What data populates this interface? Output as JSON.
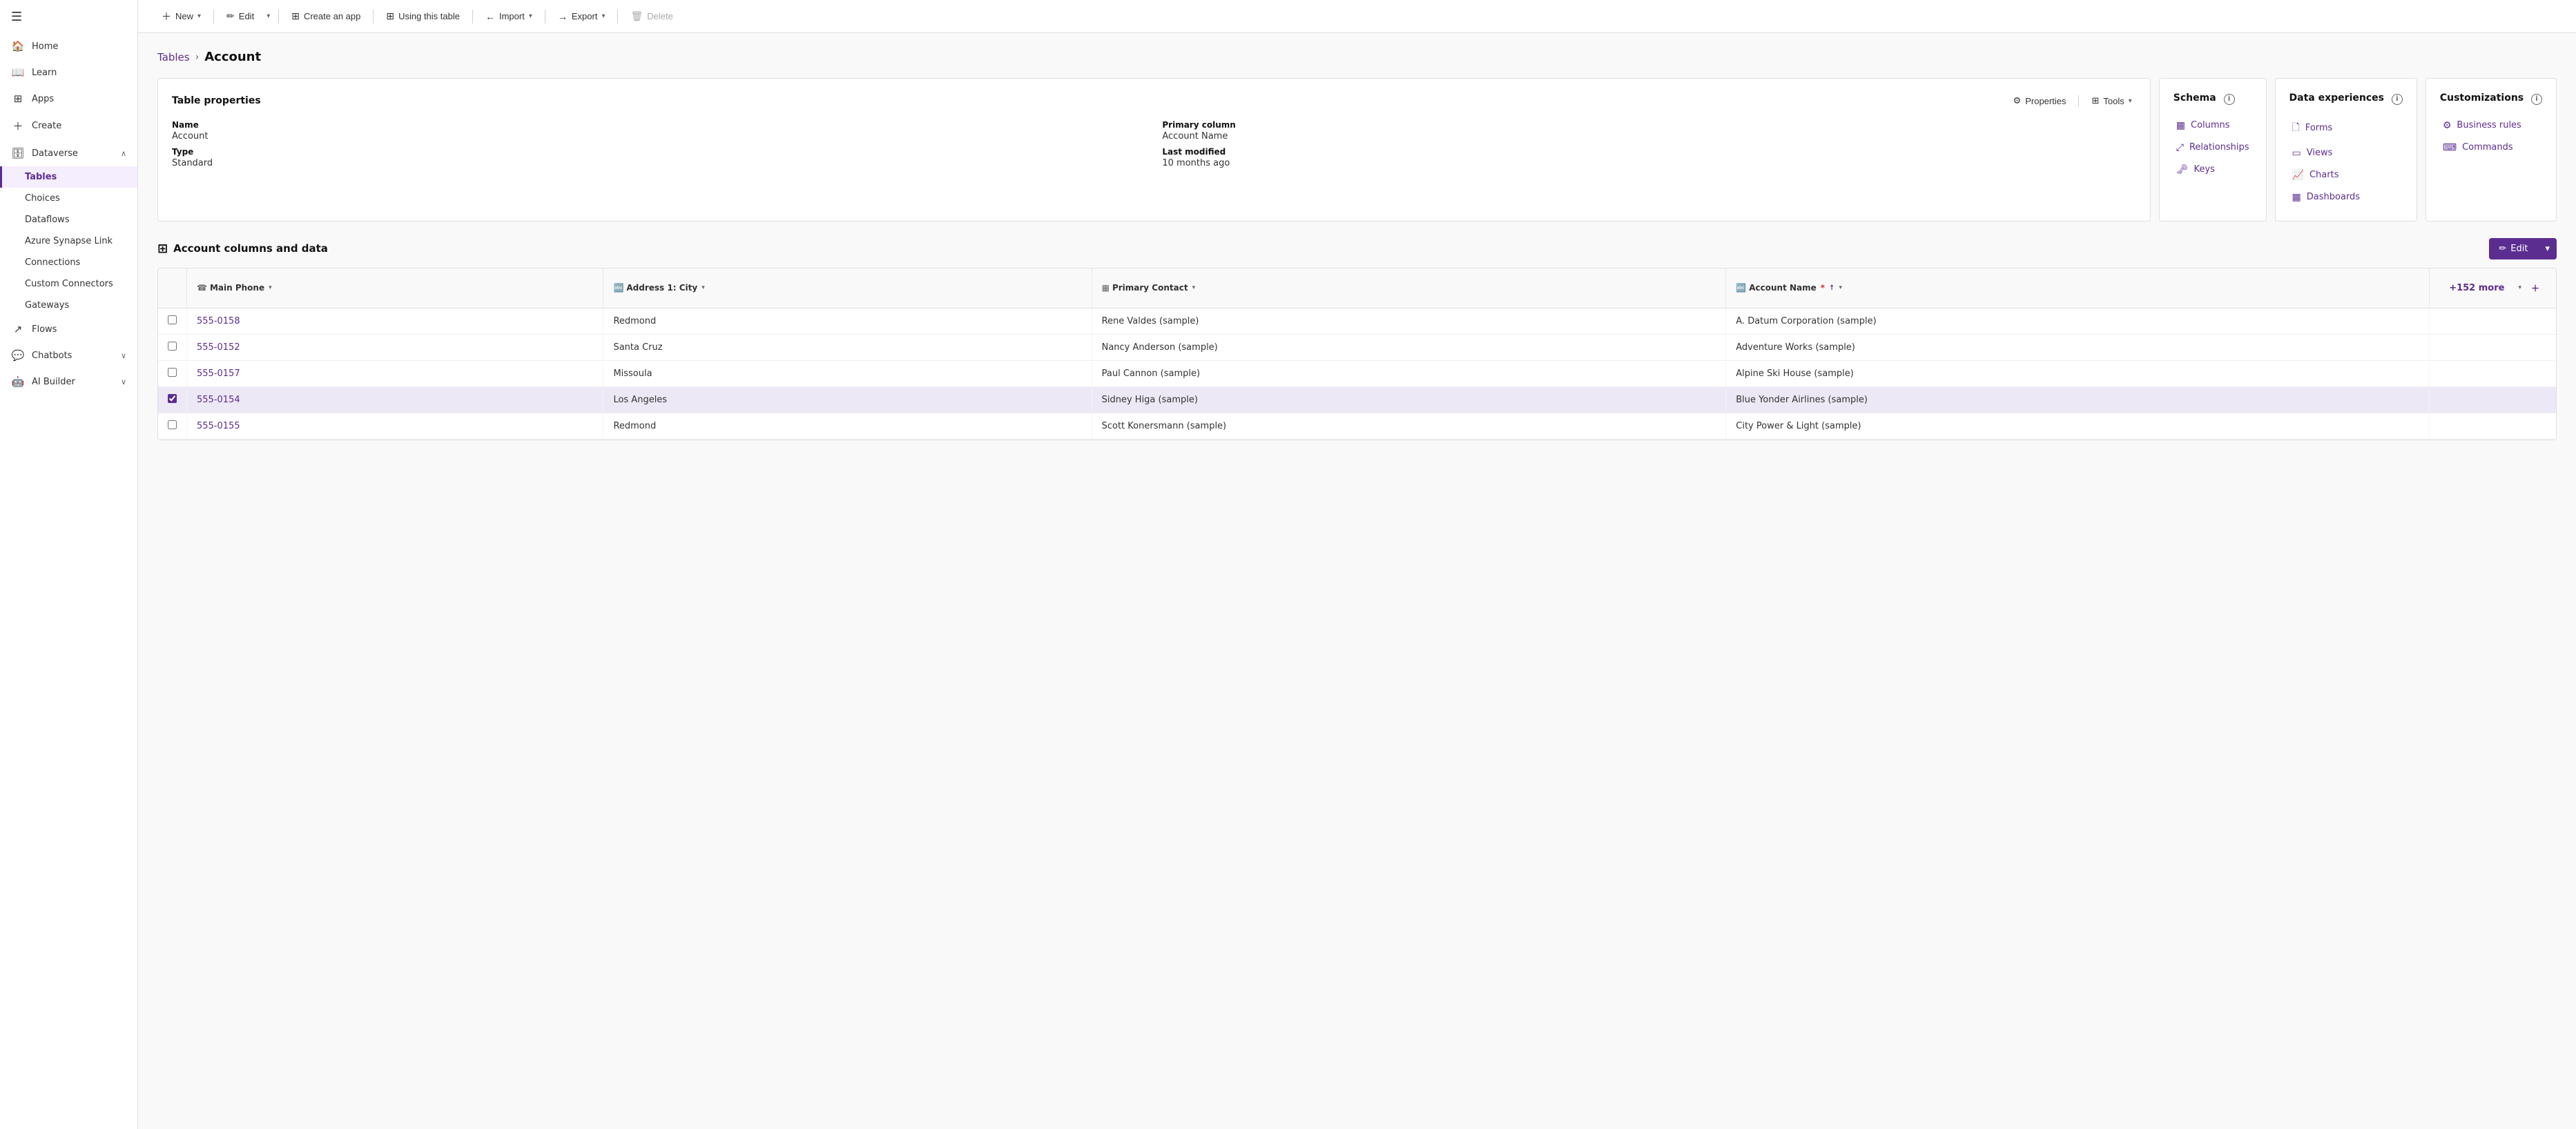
{
  "sidebar": {
    "hamburger_label": "☰",
    "items": [
      {
        "id": "home",
        "label": "Home",
        "icon": "🏠"
      },
      {
        "id": "learn",
        "label": "Learn",
        "icon": "📖"
      },
      {
        "id": "apps",
        "label": "Apps",
        "icon": "⊞"
      },
      {
        "id": "create",
        "label": "Create",
        "icon": "+"
      },
      {
        "id": "dataverse",
        "label": "Dataverse",
        "icon": "🗄",
        "expanded": true,
        "children": [
          {
            "id": "tables",
            "label": "Tables",
            "active": true
          },
          {
            "id": "choices",
            "label": "Choices"
          },
          {
            "id": "dataflows",
            "label": "Dataflows"
          },
          {
            "id": "azure-synapse",
            "label": "Azure Synapse Link"
          },
          {
            "id": "connections",
            "label": "Connections"
          },
          {
            "id": "custom-connectors",
            "label": "Custom Connectors"
          },
          {
            "id": "gateways",
            "label": "Gateways"
          }
        ]
      },
      {
        "id": "flows",
        "label": "Flows",
        "icon": "↗"
      },
      {
        "id": "chatbots",
        "label": "Chatbots",
        "icon": "💬",
        "has_children": true
      },
      {
        "id": "ai-builder",
        "label": "AI Builder",
        "icon": "🤖",
        "has_children": true
      }
    ]
  },
  "toolbar": {
    "new_label": "New",
    "edit_label": "Edit",
    "create_app_label": "Create an app",
    "using_table_label": "Using this table",
    "import_label": "Import",
    "export_label": "Export",
    "delete_label": "Delete"
  },
  "breadcrumb": {
    "parent_label": "Tables",
    "separator": "›",
    "current_label": "Account"
  },
  "table_properties_card": {
    "title": "Table properties",
    "properties_label": "Properties",
    "tools_label": "Tools",
    "name_label": "Name",
    "name_value": "Account",
    "type_label": "Type",
    "type_value": "Standard",
    "primary_column_label": "Primary column",
    "primary_column_value": "Account Name",
    "last_modified_label": "Last modified",
    "last_modified_value": "10 months ago"
  },
  "schema_card": {
    "title": "Schema",
    "links": [
      {
        "id": "columns",
        "label": "Columns",
        "icon": "▦"
      },
      {
        "id": "relationships",
        "label": "Relationships",
        "icon": "⤢"
      },
      {
        "id": "keys",
        "label": "Keys",
        "icon": "🔑"
      }
    ]
  },
  "data_experiences_card": {
    "title": "Data experiences",
    "links": [
      {
        "id": "forms",
        "label": "Forms",
        "icon": "🗋"
      },
      {
        "id": "views",
        "label": "Views",
        "icon": "▭"
      },
      {
        "id": "charts",
        "label": "Charts",
        "icon": "📈"
      },
      {
        "id": "dashboards",
        "label": "Dashboards",
        "icon": "▦"
      }
    ]
  },
  "customizations_card": {
    "title": "Customizations",
    "links": [
      {
        "id": "business-rules",
        "label": "Business rules",
        "icon": "⚙"
      },
      {
        "id": "commands",
        "label": "Commands",
        "icon": "⌨"
      }
    ]
  },
  "data_section": {
    "title": "Account columns and data",
    "edit_label": "Edit",
    "more_cols_label": "+152 more",
    "columns": [
      {
        "id": "main-phone",
        "label": "Main Phone",
        "icon": "☎",
        "type": "phone"
      },
      {
        "id": "address-city",
        "label": "Address 1: City",
        "icon": "🔤",
        "type": "text"
      },
      {
        "id": "primary-contact",
        "label": "Primary Contact",
        "icon": "▦",
        "type": "text"
      },
      {
        "id": "account-name",
        "label": "Account Name",
        "icon": "🔤",
        "type": "text",
        "required": true,
        "sorted": true
      }
    ],
    "rows": [
      {
        "id": 1,
        "main_phone": "555-0158",
        "address_city": "Redmond",
        "primary_contact": "Rene Valdes (sample)",
        "account_name": "A. Datum Corporation (sample)",
        "selected": false
      },
      {
        "id": 2,
        "main_phone": "555-0152",
        "address_city": "Santa Cruz",
        "primary_contact": "Nancy Anderson (sample)",
        "account_name": "Adventure Works (sample)",
        "selected": false
      },
      {
        "id": 3,
        "main_phone": "555-0157",
        "address_city": "Missoula",
        "primary_contact": "Paul Cannon (sample)",
        "account_name": "Alpine Ski House (sample)",
        "selected": false
      },
      {
        "id": 4,
        "main_phone": "555-0154",
        "address_city": "Los Angeles",
        "primary_contact": "Sidney Higa (sample)",
        "account_name": "Blue Yonder Airlines (sample)",
        "selected": true
      },
      {
        "id": 5,
        "main_phone": "555-0155",
        "address_city": "Redmond",
        "primary_contact": "Scott Konersmann (sample)",
        "account_name": "City Power & Light (sample)",
        "selected": false
      }
    ]
  }
}
